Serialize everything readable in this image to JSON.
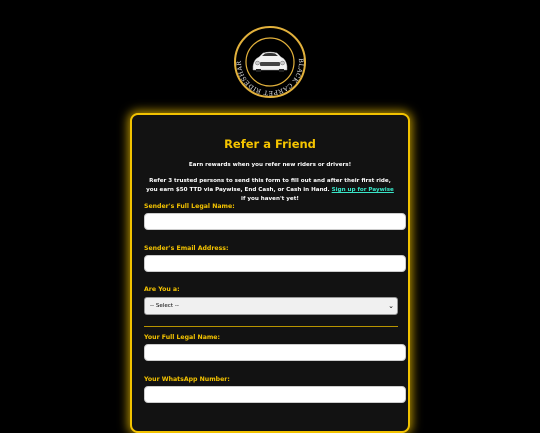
{
  "logo": {
    "text": "BLACK CARPET RIDESHARE & LOGISTICS",
    "icon": "car-icon"
  },
  "form": {
    "title": "Refer a Friend",
    "intro": "Earn rewards when you refer new riders or drivers!",
    "desc_before": "Refer 3 trusted persons to send this form to fill out and after their first ride, you earn $50 TTD via Paywise, End Cash, or Cash in Hand.",
    "desc_link": "Sign up for Paywise",
    "desc_after": "if you haven't yet!",
    "fields": {
      "sender_name_label": "Sender's Full Legal Name:",
      "sender_email_label": "Sender's Email Address:",
      "are_you_label": "Are You a:",
      "are_you_selected": "-- Select --",
      "your_name_label": "Your Full Legal Name:",
      "whatsapp_label": "Your WhatsApp Number:"
    }
  },
  "colors": {
    "accent": "#f5c400",
    "link": "#39e6c8",
    "background": "#000000",
    "card": "#121212"
  }
}
